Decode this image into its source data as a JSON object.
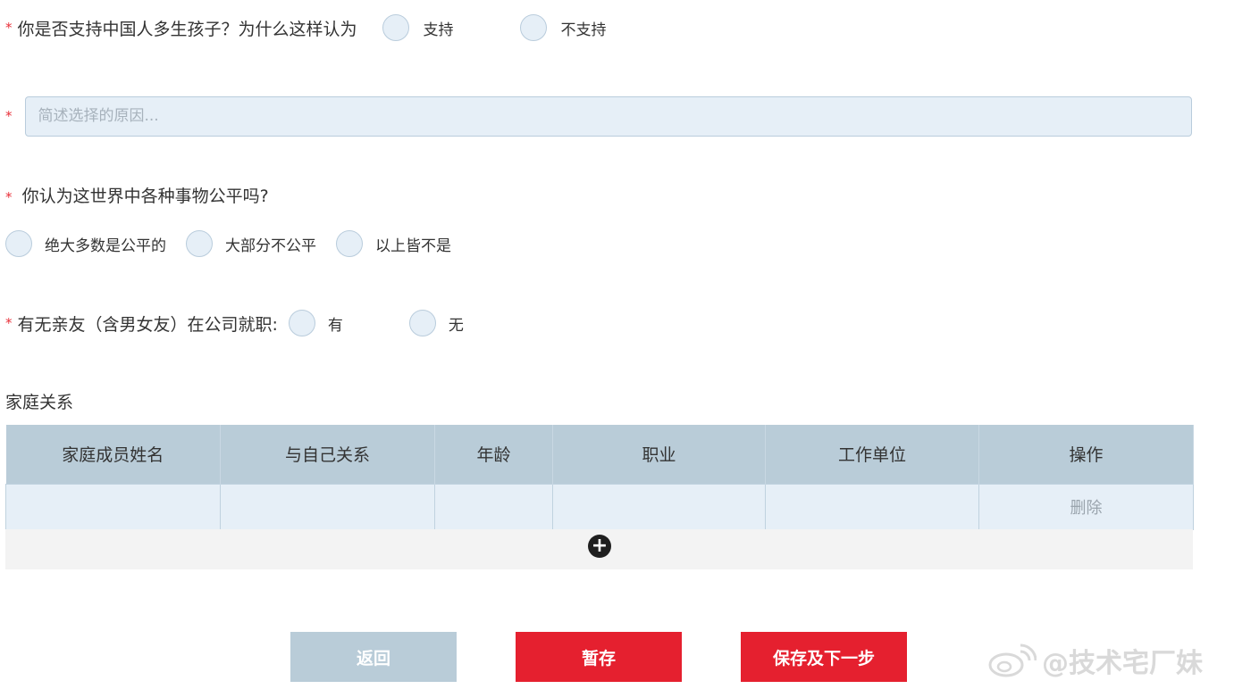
{
  "required_mark": "*",
  "q1": {
    "question": "你是否支持中国人多生孩子？为什么这样认为",
    "options": [
      "支持",
      "不支持"
    ]
  },
  "reason": {
    "placeholder": "简述选择的原因..."
  },
  "q2": {
    "question": "你认为这世界中各种事物公平吗?",
    "options": [
      "绝大多数是公平的",
      "大部分不公平",
      "以上皆不是"
    ]
  },
  "q3": {
    "question": "有无亲友（含男女友）在公司就职:",
    "options": [
      "有",
      "无"
    ]
  },
  "family": {
    "title": "家庭关系",
    "columns": [
      "家庭成员姓名",
      "与自己关系",
      "年龄",
      "职业",
      "工作单位",
      "操作"
    ],
    "rows": [
      {
        "delete_label": "删除"
      }
    ],
    "add_symbol": "+"
  },
  "buttons": {
    "back": "返回",
    "draft": "暂存",
    "save_next": "保存及下一步"
  },
  "watermark": "@技术宅厂妹",
  "colors": {
    "primary_red": "#e5202f",
    "header_blue": "#b9ccd8",
    "field_blue": "#e6eff7"
  }
}
